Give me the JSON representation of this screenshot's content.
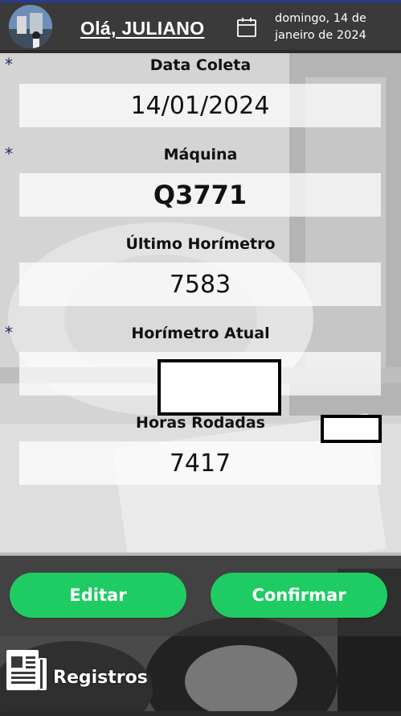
{
  "header": {
    "greeting": "Olá, JULIANO",
    "date_line1": "domingo, 14 de",
    "date_line2": "janeiro de 2024",
    "icons": {
      "avatar": "user-avatar",
      "calendar": "calendar-icon"
    }
  },
  "form": {
    "required_mark": "*",
    "fields": [
      {
        "label": "Data Coleta",
        "value": "14/01/2024",
        "required": true
      },
      {
        "label": "Máquina",
        "value": "Q3771",
        "required": true
      },
      {
        "label": "Último Horímetro",
        "value": "7583",
        "required": false
      },
      {
        "label": "Horímetro Atual",
        "value": "",
        "required": true
      },
      {
        "label": "Horas Rodadas",
        "value": "7417",
        "required": false
      }
    ]
  },
  "actions": {
    "edit_label": "Editar",
    "confirm_label": "Confirmar"
  },
  "footer": {
    "registros_label": "Registros",
    "registros_icon": "document-icon"
  },
  "colors": {
    "header_bg": "#3a3a3a",
    "accent_green": "#1fcc63",
    "asterisk": "#1e2a6e"
  }
}
